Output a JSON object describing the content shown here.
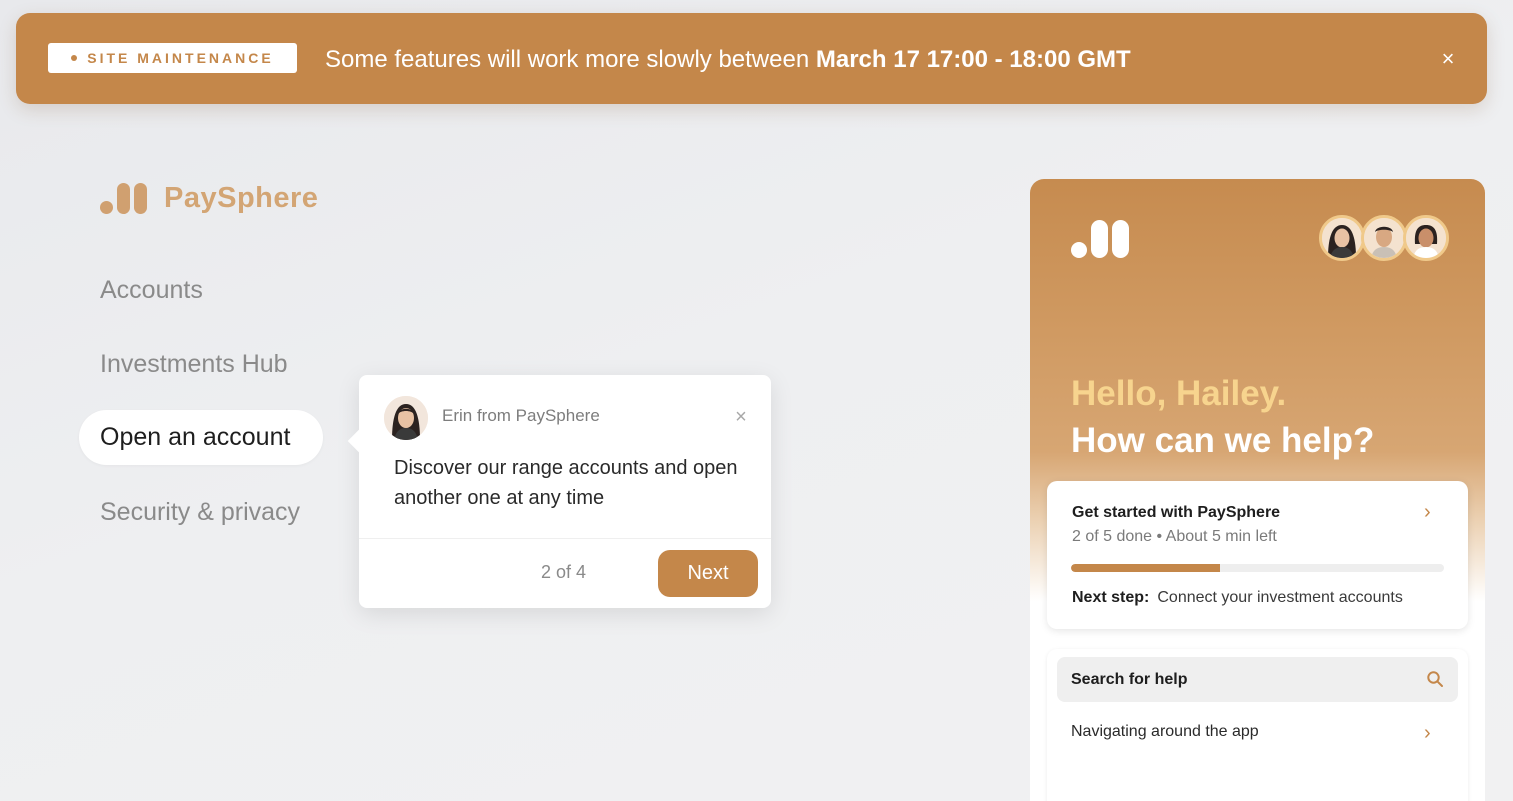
{
  "banner": {
    "badge": "SITE MAINTENANCE",
    "message": "Some features will work more slowly between ",
    "window": "March 17 17:00 - 18:00 GMT",
    "close_icon": "×",
    "color": "#c4874a"
  },
  "brand": {
    "name": "PaySphere",
    "logo_icon": "paysphere-logo"
  },
  "nav": {
    "items": [
      "Accounts",
      "Investments Hub",
      "Open an account",
      "Security & privacy"
    ],
    "active": "Open an account"
  },
  "tour": {
    "sender": "Erin from PaySphere",
    "message": "Discover our range accounts and open another one at any time",
    "step": "2 of 4",
    "next_label": "Next",
    "close_icon": "×"
  },
  "panel": {
    "greeting_line1": "Hello, Hailey.",
    "greeting_line2": "How can we help?",
    "team_avatars": [
      "support-agent-1",
      "support-agent-2",
      "support-agent-3"
    ],
    "onboarding": {
      "title": "Get started with PaySphere",
      "progress_text": "2 of 5 done • About 5 min left",
      "progress_fraction": 0.4,
      "next_step_label": "Next step:",
      "next_step_value": "Connect your investment accounts",
      "chevron": "›"
    },
    "search": {
      "label": "Search for help",
      "icon": "search-icon"
    },
    "help_links": [
      {
        "label": "Navigating around the app",
        "chevron": "›"
      }
    ]
  }
}
